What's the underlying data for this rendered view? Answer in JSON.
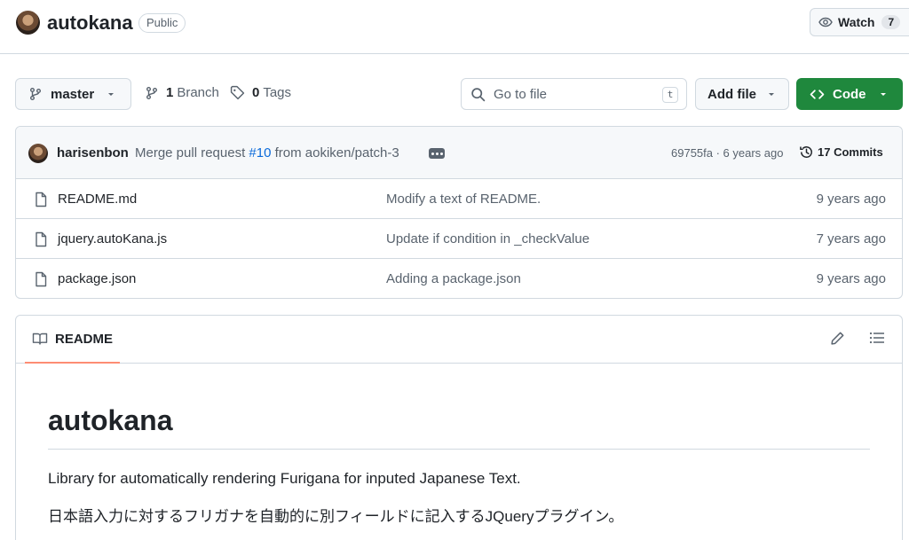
{
  "repo": {
    "name": "autokana",
    "visibility": "Public",
    "watch_label": "Watch",
    "watch_count": "7"
  },
  "toolbar": {
    "branch": "master",
    "branch_count": "1",
    "branch_label": "Branch",
    "tag_count": "0",
    "tag_label": "Tags",
    "search_placeholder": "Go to file",
    "search_shortcut": "t",
    "add_file_label": "Add file",
    "code_label": "Code"
  },
  "commit": {
    "author": "harisenbon",
    "message_prefix": "Merge pull request",
    "pr_number": "#10",
    "message_suffix": "from aokiken/patch-3",
    "hash_time": "69755fa · 6 years ago",
    "commit_count": "17 Commits"
  },
  "files": [
    {
      "name": "README.md",
      "commit_message": "Modify a text of README.",
      "age": "9 years ago"
    },
    {
      "name": "jquery.autoKana.js",
      "commit_message": "Update if condition in _checkValue",
      "age": "7 years ago"
    },
    {
      "name": "package.json",
      "commit_message": "Adding a package.json",
      "age": "9 years ago"
    }
  ],
  "readme": {
    "tab_label": "README",
    "title": "autokana",
    "paragraphs": [
      "Library for automatically rendering Furigana for inputed Japanese Text.",
      "日本語入力に対するフリガナを自動的に別フィールドに記入するJQueryプラグイン。"
    ]
  },
  "icons": {
    "branch": "git-branch-icon",
    "tag": "tag-icon",
    "search": "search-icon",
    "code": "code-icon",
    "history": "history-icon",
    "file": "file-icon",
    "book": "book-icon",
    "edit": "pencil-icon",
    "outline": "list-icon",
    "eye": "eye-icon"
  },
  "colors": {
    "primary_button": "#1f883d",
    "link": "#0969da",
    "tab_underline": "#fd8c73",
    "muted_text": "#59636e",
    "border": "#d1d9e0"
  }
}
